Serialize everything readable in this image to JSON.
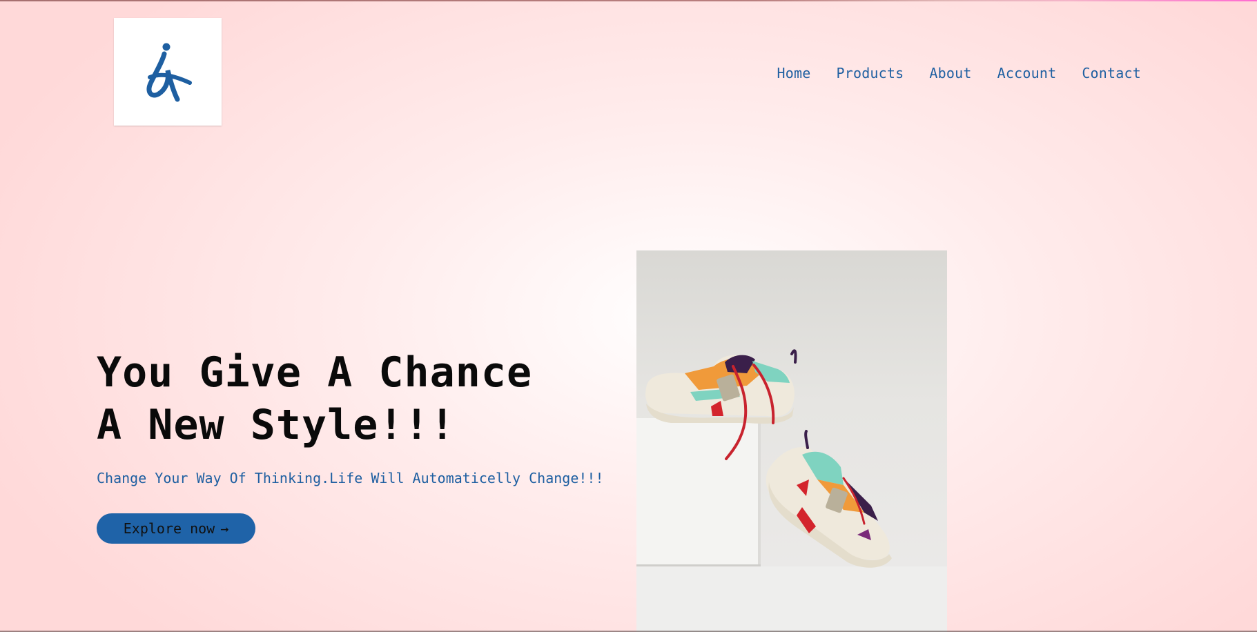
{
  "logo": {
    "icon": "letter-a-person-logo",
    "color": "#1e5fa1"
  },
  "nav": {
    "items": [
      {
        "label": "Home"
      },
      {
        "label": "Products"
      },
      {
        "label": "About"
      },
      {
        "label": "Account"
      },
      {
        "label": "Contact"
      }
    ]
  },
  "hero": {
    "title_line1": "You Give A Chance",
    "title_line2": "A New Style!!!",
    "tagline": "Change Your Way Of Thinking.Life Will Automaticelly Change!!!",
    "cta_label": "Explore now",
    "cta_arrow": "→"
  },
  "image": {
    "subject": "sneakers-photo"
  },
  "colors": {
    "accent": "#1e5fa1",
    "button": "#1f63a8",
    "background": "#ffd9d9"
  }
}
